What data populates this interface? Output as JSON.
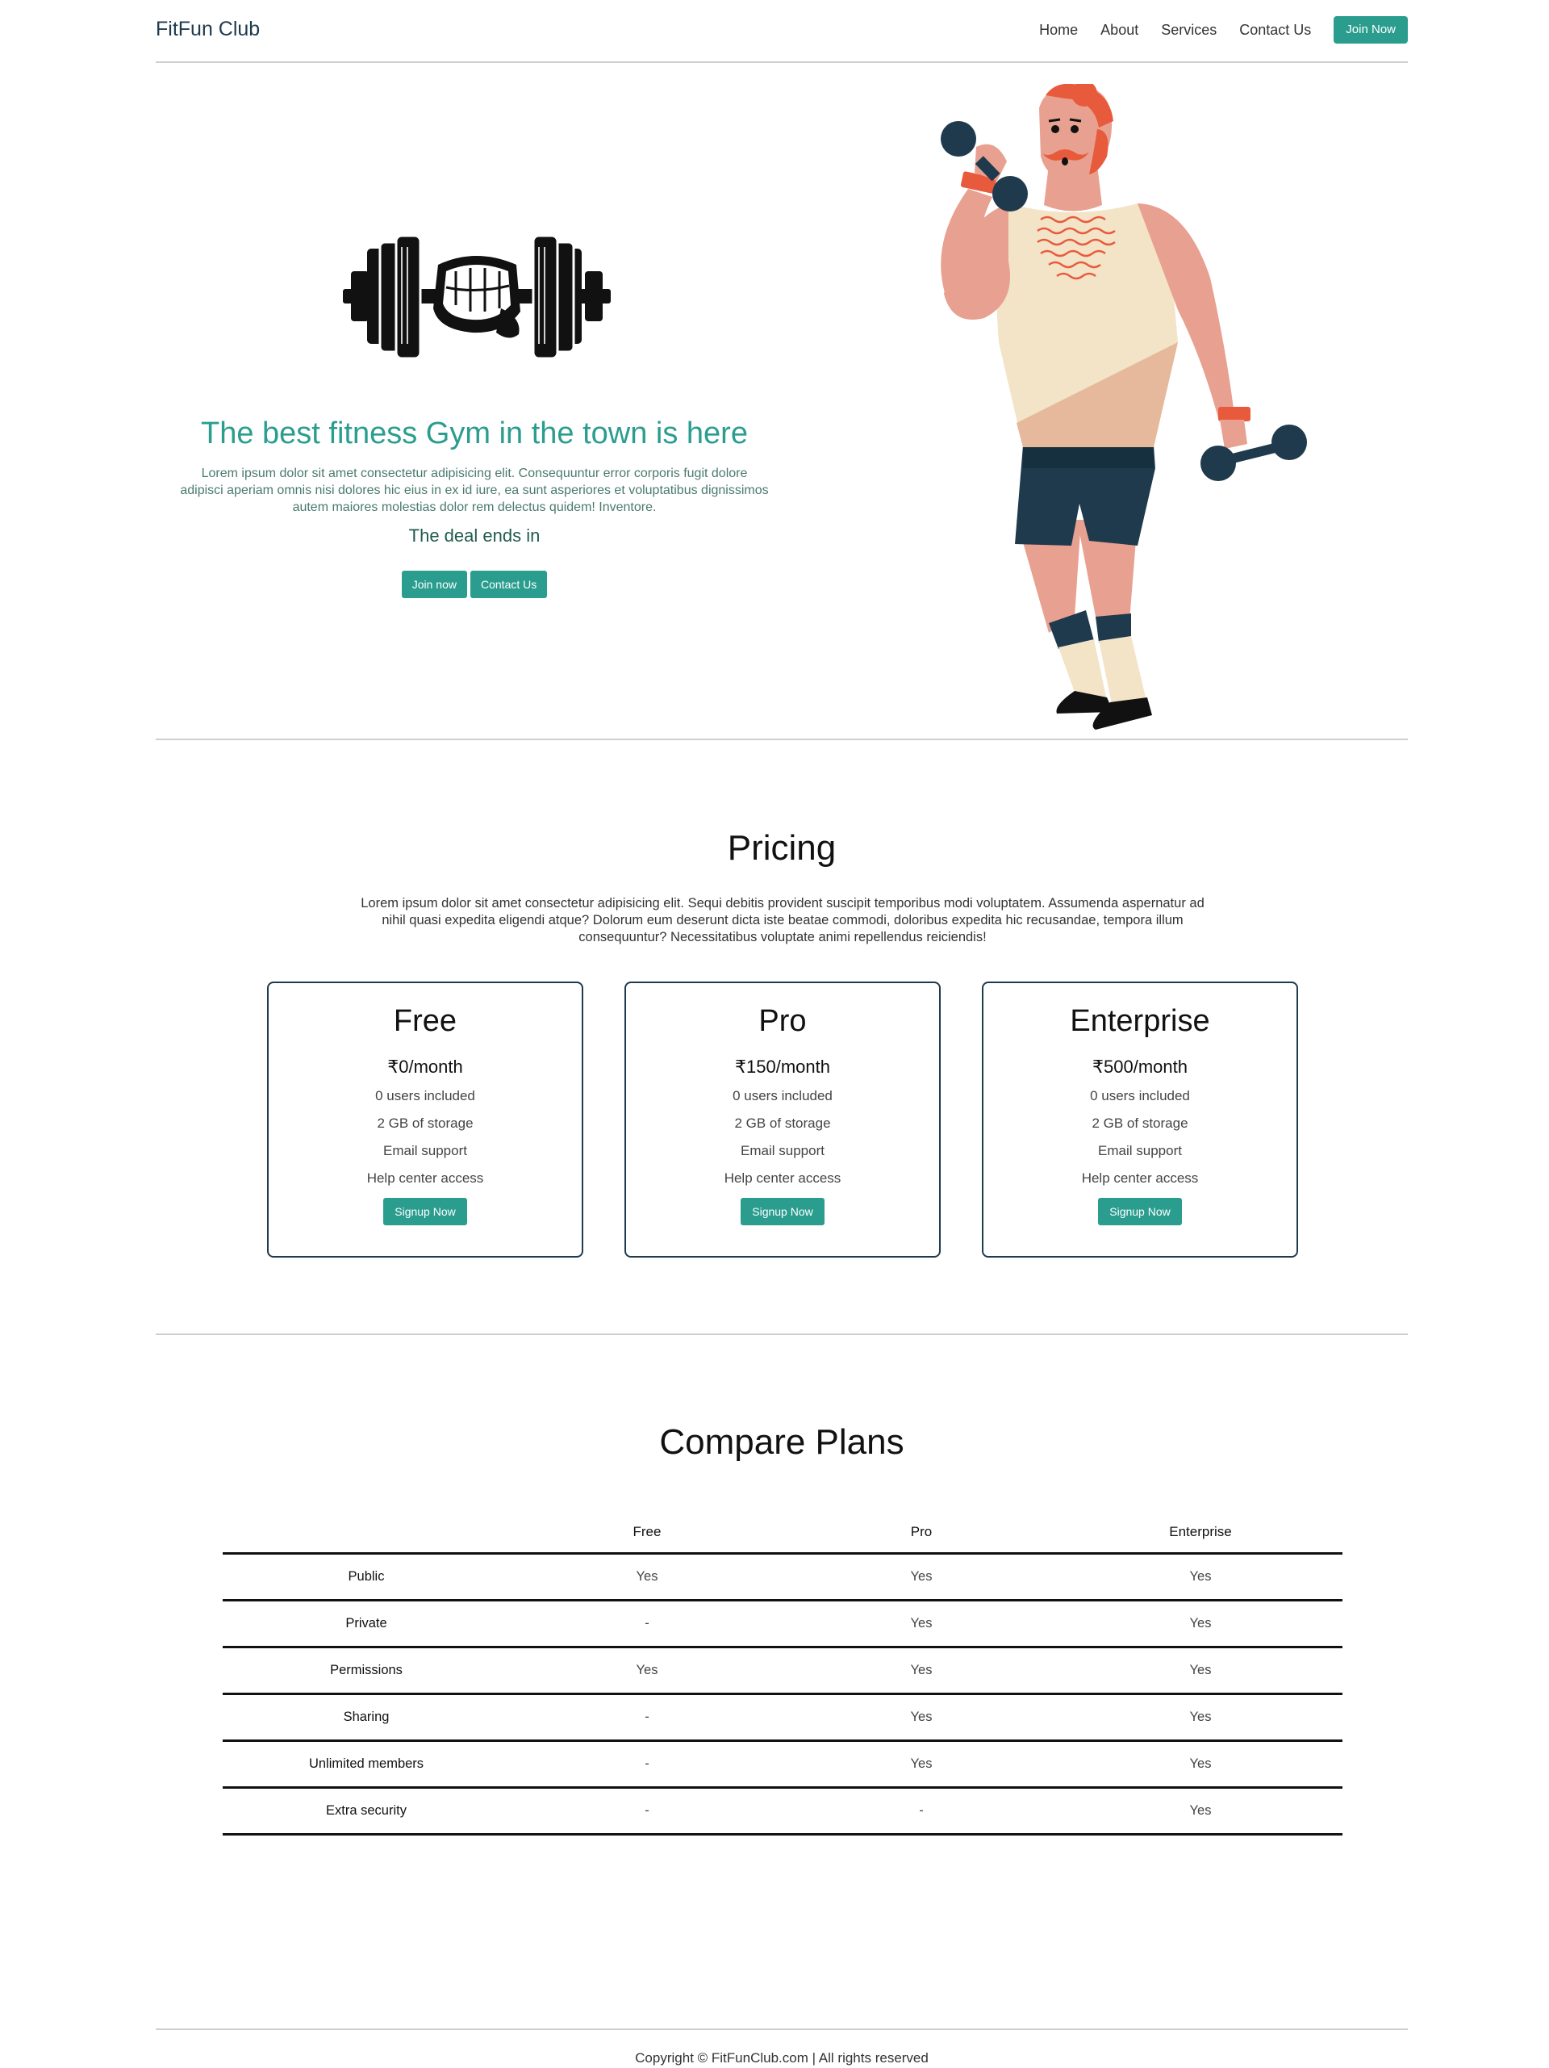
{
  "navbar": {
    "brand": "FitFun Club",
    "links": [
      "Home",
      "About",
      "Services",
      "Contact Us"
    ],
    "cta": "Join Now"
  },
  "hero": {
    "title": "The best fitness Gym in the town is here",
    "description": "Lorem ipsum dolor sit amet consectetur adipisicing elit. Consequuntur error corporis fugit dolore adipisci aperiam omnis nisi dolores hic eius in ex id iure, ea sunt asperiores et voluptatibus dignissimos autem maiores molestias dolor rem delectus quidem! Inventore.",
    "deal": "The deal ends in",
    "buttons": [
      "Join now",
      "Contact Us"
    ]
  },
  "pricing": {
    "title": "Pricing",
    "description": "Lorem ipsum dolor sit amet consectetur adipisicing elit. Sequi debitis provident suscipit temporibus modi voluptatem. Assumenda aspernatur ad nihil quasi expedita eligendi atque? Dolorum eum deserunt dicta iste beatae commodi, doloribus expedita hic recusandae, tempora illum consequuntur? Necessitatibus voluptate animi repellendus reiciendis!",
    "plans": [
      {
        "name": "Free",
        "price": "₹0/month",
        "features": [
          "0 users included",
          "2 GB of storage",
          "Email support",
          "Help center access"
        ],
        "button": "Signup Now"
      },
      {
        "name": "Pro",
        "price": "₹150/month",
        "features": [
          "0 users included",
          "2 GB of storage",
          "Email support",
          "Help center access"
        ],
        "button": "Signup Now"
      },
      {
        "name": "Enterprise",
        "price": "₹500/month",
        "features": [
          "0 users included",
          "2 GB of storage",
          "Email support",
          "Help center access"
        ],
        "button": "Signup Now"
      }
    ]
  },
  "compare": {
    "title": "Compare Plans",
    "headers": [
      "",
      "Free",
      "Pro",
      "Enterprise"
    ],
    "rows": [
      [
        "Public",
        "Yes",
        "Yes",
        "Yes"
      ],
      [
        "Private",
        "-",
        "Yes",
        "Yes"
      ],
      [
        "Permissions",
        "Yes",
        "Yes",
        "Yes"
      ],
      [
        "Sharing",
        "-",
        "Yes",
        "Yes"
      ],
      [
        "Unlimited members",
        "-",
        "Yes",
        "Yes"
      ],
      [
        "Extra security",
        "-",
        "-",
        "Yes"
      ]
    ]
  },
  "footer": {
    "text": "Copyright © FitFunClub.com | All rights reserved"
  },
  "colors": {
    "accent": "#2a9d8f",
    "dark": "#1f3a4d",
    "skin": "#e8a090",
    "tank": "#f3e3c7",
    "hair": "#e85a3c"
  },
  "icons": {
    "logo": "dumbbell-fist-icon",
    "illustration": "weightlifter-illustration"
  }
}
